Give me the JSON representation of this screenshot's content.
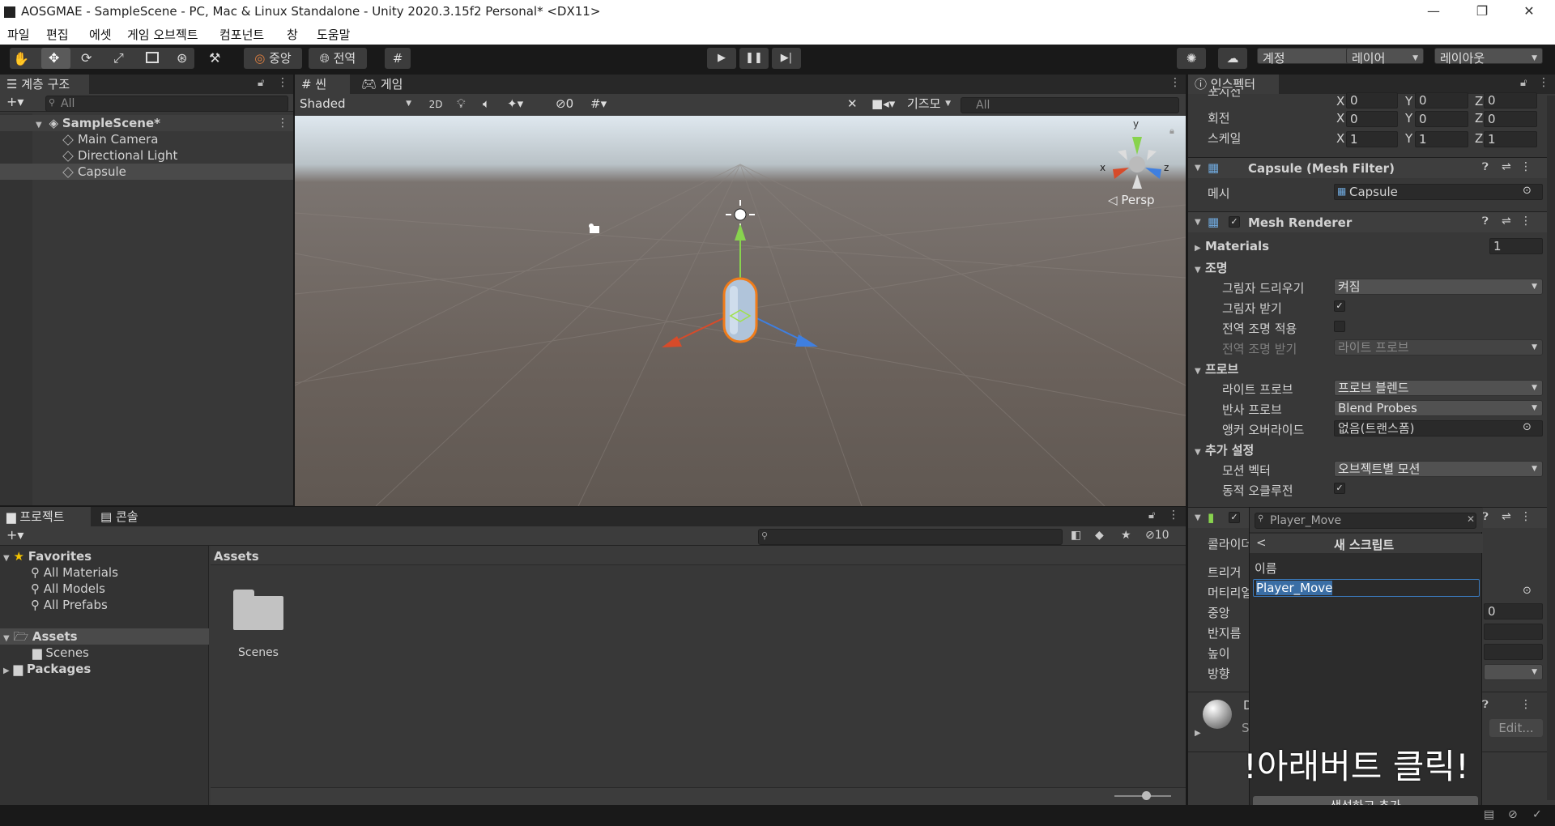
{
  "window": {
    "title": "AOSGMAE - SampleScene - PC, Mac & Linux Standalone - Unity 2020.3.15f2 Personal* <DX11>",
    "minimize": "—",
    "maximize": "❐",
    "close": "✕"
  },
  "menu": [
    "파일",
    "편집",
    "에셋",
    "게임 오브젝트",
    "컴포넌트",
    "창",
    "도움말"
  ],
  "toolbar": {
    "pivot_label": "중앙",
    "global_label": "전역",
    "account_label": "계정",
    "layers_label": "레이어",
    "layout_label": "레이아웃"
  },
  "hierarchy": {
    "tab_label": "계층 구조",
    "search_placeholder": "All",
    "scene_name": "SampleScene*",
    "items": [
      "Main Camera",
      "Directional Light",
      "Capsule"
    ]
  },
  "scene_view": {
    "tab_scene": "씬",
    "tab_game": "게임",
    "shading_mode": "Shaded",
    "mode_2d": "2D",
    "hidden_count": "0",
    "gizmos_label": "기즈모",
    "search_placeholder": "All",
    "persp_label": "Persp",
    "axis_x": "x",
    "axis_y": "y",
    "axis_z": "z"
  },
  "project": {
    "tab_project": "프로젝트",
    "tab_console": "콘솔",
    "favorites_label": "Favorites",
    "favorites": [
      "All Materials",
      "All Models",
      "All Prefabs"
    ],
    "assets_label": "Assets",
    "scenes_label": "Scenes",
    "packages_label": "Packages",
    "breadcrumb": "Assets",
    "folder_name": "Scenes",
    "hidden_count": "10"
  },
  "inspector": {
    "tab_label": "인스펙터",
    "transform": {
      "position_label": "포지션",
      "rotation_label": "회전",
      "scale_label": "스케일",
      "position": {
        "x": "0",
        "y": "0",
        "z": "0"
      },
      "rotation": {
        "x": "0",
        "y": "0",
        "z": "0"
      },
      "scale": {
        "x": "1",
        "y": "1",
        "z": "1"
      },
      "x": "X",
      "y": "Y",
      "z": "Z"
    },
    "mesh_filter": {
      "title": "Capsule (Mesh Filter)",
      "mesh_label": "메시",
      "mesh_value": "Capsule"
    },
    "mesh_renderer": {
      "title": "Mesh Renderer",
      "materials_label": "Materials",
      "materials_count": "1",
      "lighting_label": "조명",
      "cast_shadows_label": "그림자 드리우기",
      "cast_shadows_value": "켜짐",
      "receive_shadows_label": "그림자 받기",
      "contribute_gi_label": "전역 조명 적용",
      "receive_gi_label": "전역 조명 받기",
      "receive_gi_value": "라이트 프로브",
      "probes_label": "프로브",
      "light_probes_label": "라이트 프로브",
      "light_probes_value": "프로브 블렌드",
      "reflection_probes_label": "반사 프로브",
      "reflection_probes_value": "Blend Probes",
      "anchor_override_label": "앵커 오버라이드",
      "anchor_override_value": "없음(트랜스폼)",
      "additional_label": "추가 설정",
      "motion_vectors_label": "모션 벡터",
      "motion_vectors_value": "오브젝트별 모션",
      "dynamic_occlusion_label": "동적 오클루전"
    },
    "collider": {
      "collider_label": "콜라이더",
      "trigger_label": "트리거",
      "material_label": "머티리얼",
      "center_label": "중앙",
      "radius_label": "반지름",
      "height_label": "높이",
      "direction_label": "방향",
      "center_z": "0"
    },
    "material": {
      "letter_d": "D",
      "letter_s": "S",
      "edit_label": "Edit..."
    }
  },
  "add_component_popup": {
    "search_value": "Player_Move",
    "title": "새 스크립트",
    "back": "<",
    "name_label": "이름",
    "name_value": "Player_Move",
    "overlay_text": "!아래버트 클릭!",
    "create_button": "생성하고 추가"
  }
}
